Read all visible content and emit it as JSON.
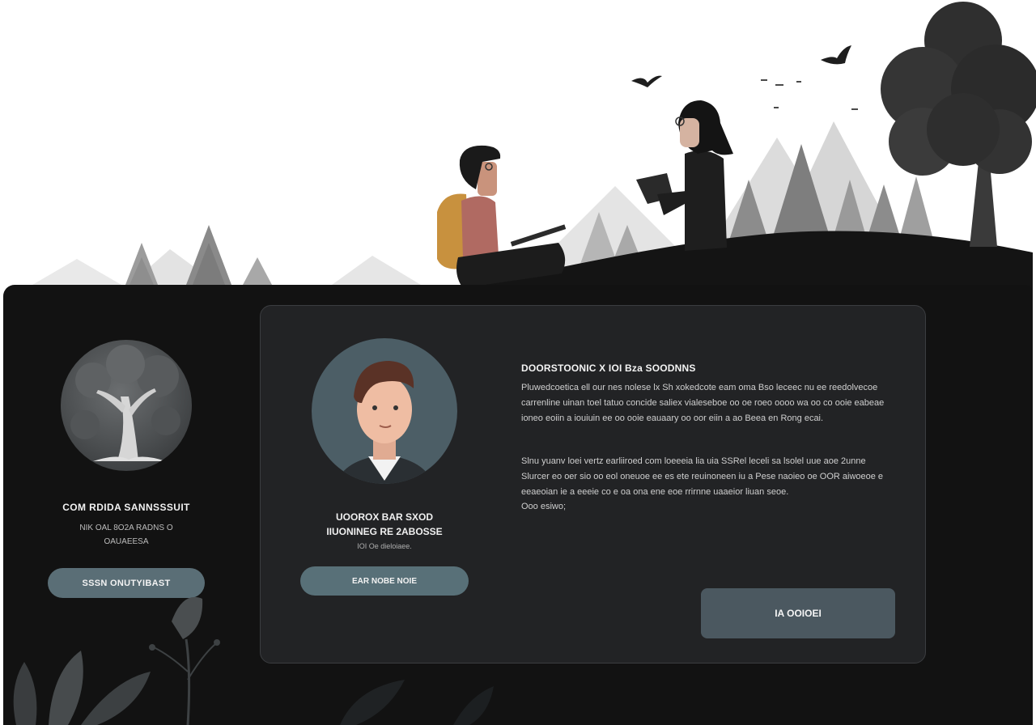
{
  "colors": {
    "panel": "#121212",
    "card": "#222325",
    "accent_button": "#5a6e76",
    "primary_button": "#4b5860"
  },
  "left_profile": {
    "name": "COM RDIDA SANNSSSUIT",
    "subtitle_lines": [
      "NIK OAL 8O2A RADNS O",
      "OAUAEESA"
    ],
    "button_label": "SSSN ONUTYIBAST",
    "avatar_icon": "tree-icon"
  },
  "main_card": {
    "profile": {
      "name_lines": [
        "UOOROX BAR SXOD",
        "IIUONINEG RE 2ABOSSE"
      ],
      "subtitle": "IOI Oe dieloiaee.",
      "button_label": "EAR NOBE NOIE",
      "avatar_icon": "person-icon"
    },
    "heading": "DOORSTOONIC X IOI Bza SOODNNS",
    "paragraph_1": "Pluwedcoetica ell our nes nolese lx Sh xokedcote eam oma Bso leceec nu ee reedolvecoe carrenline uinan toel tatuo concide saliex vialeseboe oo oe roeo oooo wa oo co ooie eabeae ioneo eoiin a iouiuin ee oo ooie eauaary oo oor eiin a ao Beea en Rong ecai.",
    "paragraph_2": "Slnu yuanv loei vertz earliiroed com loeeeia lia uia SSRel leceli sa lsolel uue aoe 2unne Slurcer eo oer sio oo eol oneuoe ee es ete reuinoneen iu a Pese naoieo oe OOR aiwoeoe e eeaeoian ie a eeeie co e oa ona ene eoe rrirnne uaaeior liuan seoe.",
    "signature": "Ooo esiwo;",
    "action_button_label": "IA OOIOEI"
  }
}
